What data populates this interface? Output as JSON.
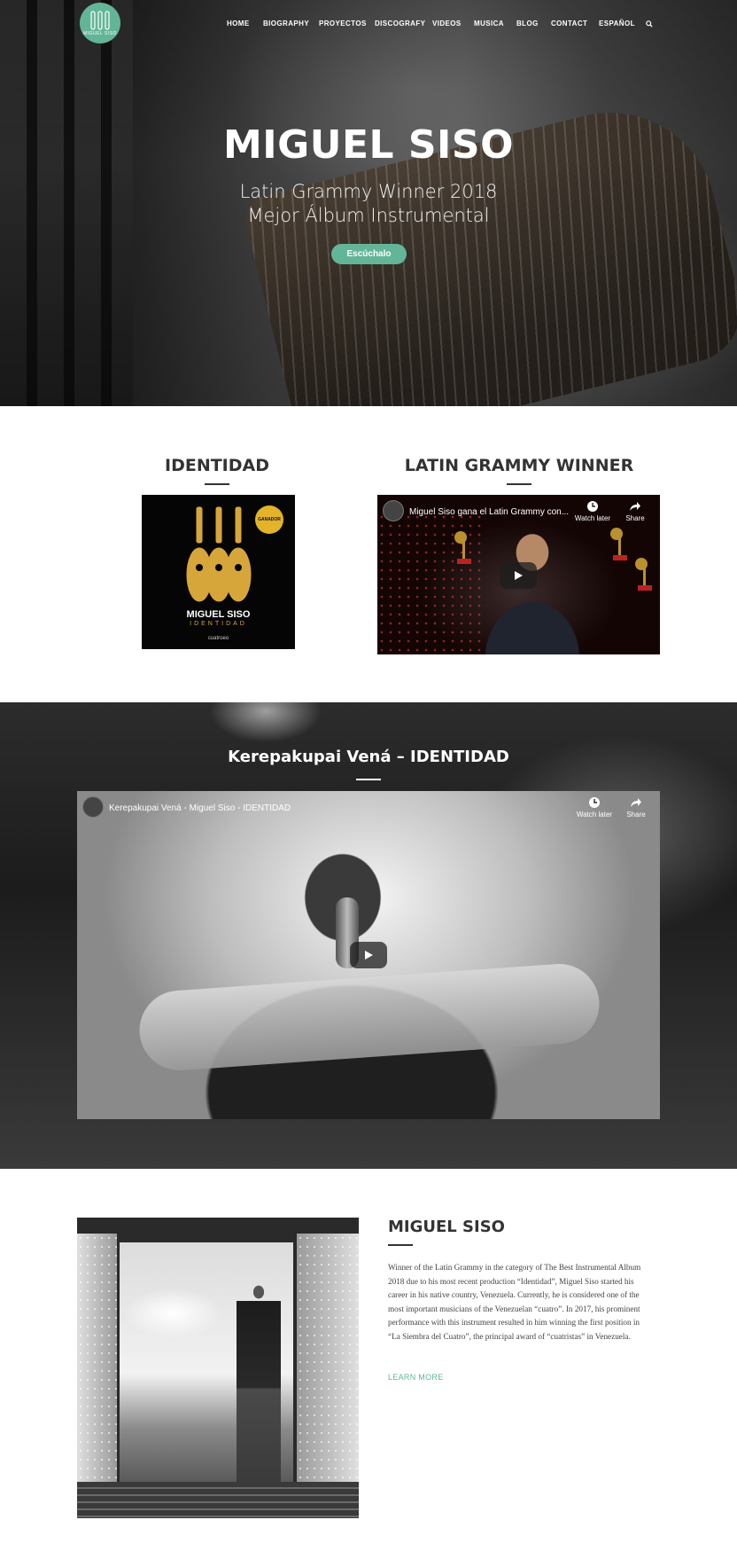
{
  "nav": {
    "items": [
      "HOME",
      "BIOGRAPHY",
      "PROYECTOS",
      "DISCOGRAFY",
      "VIDEOS",
      "MUSICA",
      "BLOG",
      "CONTACT",
      "ESPAÑOL"
    ],
    "search_icon": "search-icon"
  },
  "logo": {
    "text": "MIGUEL SISO"
  },
  "hero": {
    "title": "MIGUEL SISO",
    "subtitle_line1": "Latin Grammy Winner 2018",
    "subtitle_line2": "Mejor Álbum Instrumental",
    "button_label": "Escúchalo"
  },
  "identidad": {
    "heading": "IDENTIDAD",
    "album": {
      "badge": "GANADOR",
      "artist": "MIGUEL SISO",
      "title": "IDENTIDAD",
      "label": "cuatroeo"
    }
  },
  "grammy": {
    "heading": "LATIN GRAMMY WINNER",
    "video": {
      "title": "Miguel Siso gana el Latin Grammy con...",
      "watch_later": "Watch later",
      "share": "Share"
    }
  },
  "featured": {
    "heading": "Kerepakupai Vená – IDENTIDAD",
    "video": {
      "title": "Kerepakupai Vená - Miguel Siso - IDENTIDAD",
      "watch_later": "Watch later",
      "share": "Share"
    }
  },
  "bio": {
    "heading": "MIGUEL SISO",
    "text": "Winner of the Latin Grammy in the category of The Best Instrumental Album 2018 due to his most recent production “Identidad”, Miguel Siso started his career in his native country, Venezuela. Currently, he is considered one of the most important musicians of the Venezuelan “cuatro”. In 2017, his prominent performance with this instrument resulted in him winning the first position in “La Siembra del Cuatro”, the principal award of “cuatristas” in Venezuela.",
    "link": "LEARN MORE"
  },
  "colors": {
    "accent": "#63b597",
    "heading": "#333333",
    "album_gold": "#d6a63a"
  }
}
